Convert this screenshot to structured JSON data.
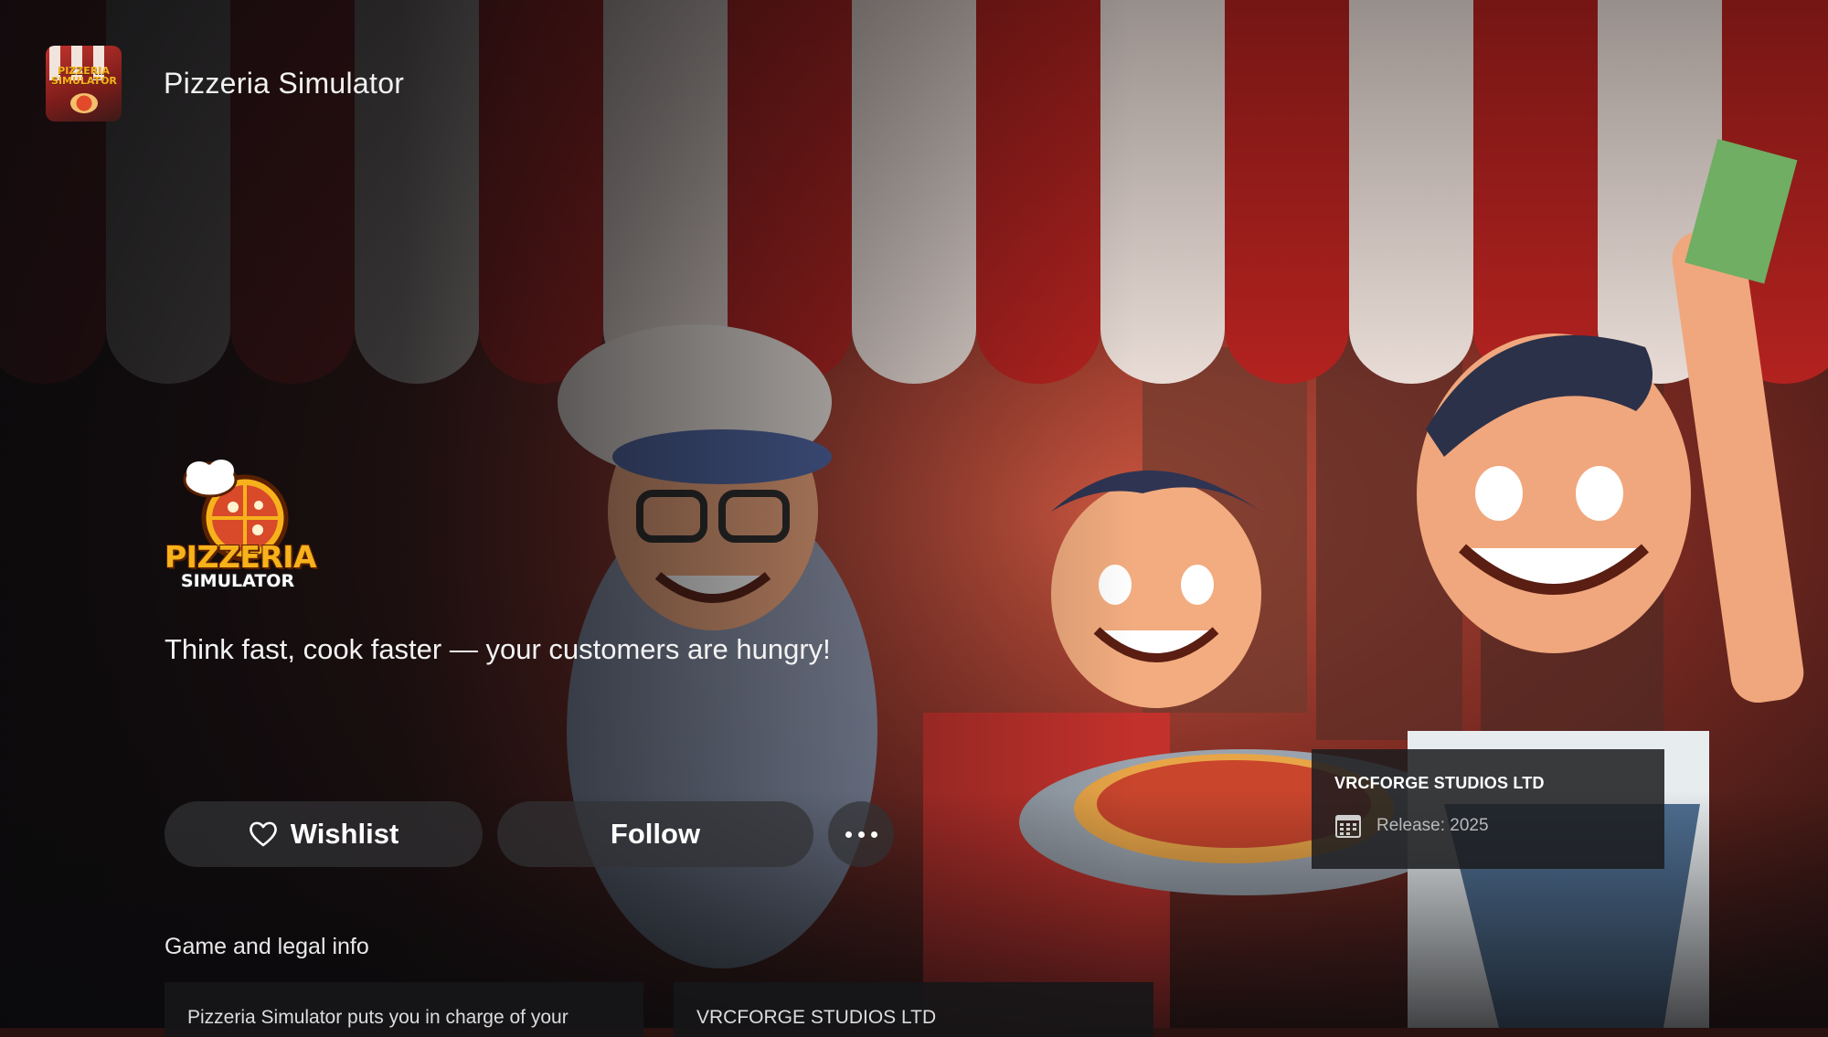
{
  "header": {
    "title": "Pizzeria Simulator",
    "app_icon_text": "PIZZERIA SIMULATOR",
    "app_icon": "game-icon"
  },
  "hero": {
    "logo_line1": "PIZZERIA",
    "logo_line2": "SIMULATOR",
    "tagline": "Think fast, cook faster — your customers are hungry!"
  },
  "actions": {
    "wishlist_label": "Wishlist",
    "wishlist_icon": "heart-icon",
    "follow_label": "Follow",
    "more_icon": "more-options-icon"
  },
  "info": {
    "publisher": "VRCFORGE STUDIOS LTD",
    "release": "Release: 2025",
    "release_icon": "calendar-icon"
  },
  "legal": {
    "section_title": "Game and legal info",
    "description_preview": "Pizzeria Simulator puts you in charge of your",
    "publisher_preview": "VRCFORGE STUDIOS LTD"
  },
  "colors": {
    "awning_red": "#b3221f",
    "awning_white": "#e9dcd6",
    "logo_yellow": "#f7b21b",
    "button_bg": "#323234"
  }
}
